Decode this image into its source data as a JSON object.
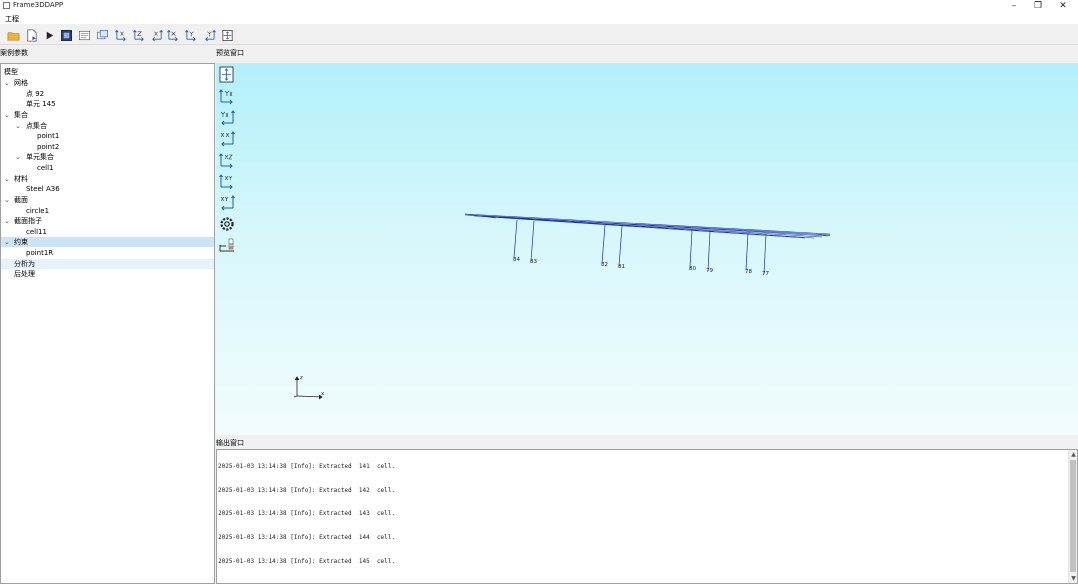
{
  "window": {
    "title": "Frame3DDAPP",
    "controls": {
      "minimize": "–",
      "restore": "❐",
      "close": "✕"
    }
  },
  "menu": {
    "items": [
      "工程"
    ]
  },
  "toolbar": {
    "buttons": [
      "folder-icon",
      "new-file-icon",
      "run-icon",
      "model-view-icon",
      "frame-view-icon",
      "window-view-icon",
      "view-yz-icon",
      "view-zy-icon",
      "view-xz-icon",
      "view-zx-icon",
      "view-xy-icon",
      "view-yx-icon",
      "fit-view-icon"
    ]
  },
  "panels": {
    "left_label": "案例参数",
    "center_label": "预览窗口",
    "log_label": "输出窗口"
  },
  "tree": [
    {
      "label": "模型",
      "level": 0
    },
    {
      "label": "网格",
      "level": 1,
      "expanded": true
    },
    {
      "label": "点 92",
      "level": 2
    },
    {
      "label": "单元 145",
      "level": 2
    },
    {
      "label": "集合",
      "level": 1,
      "expanded": true
    },
    {
      "label": "点集合",
      "level": 2,
      "expanded": true
    },
    {
      "label": "point1",
      "level": 3
    },
    {
      "label": "point2",
      "level": 3
    },
    {
      "label": "单元集合",
      "level": 2,
      "expanded": true
    },
    {
      "label": "cell1",
      "level": 3
    },
    {
      "label": "材料",
      "level": 1,
      "expanded": true
    },
    {
      "label": "Steel A36",
      "level": 2
    },
    {
      "label": "截面",
      "level": 1,
      "expanded": true
    },
    {
      "label": "circle1",
      "level": 2
    },
    {
      "label": "截面指子",
      "level": 1,
      "expanded": true
    },
    {
      "label": "cell11",
      "level": 2
    },
    {
      "label": "约束",
      "level": 1,
      "expanded": true,
      "selected": true
    },
    {
      "label": "point1R",
      "level": 2
    },
    {
      "label": "分析为",
      "level": 1,
      "hover": true
    },
    {
      "label": "后处理",
      "level": 1
    }
  ],
  "viewport": {
    "tools": [
      "select-view-icon",
      "view-front-icon",
      "view-back-icon",
      "view-left-icon",
      "view-right-icon",
      "view-top-icon",
      "view-bottom-icon",
      "settings-icon",
      "legend-icon"
    ],
    "labels": [
      "84",
      "83",
      "82",
      "81",
      "80",
      "79",
      "78",
      "77"
    ],
    "axis_labels": {
      "x": "x",
      "z": "z"
    },
    "accent_color": "#1a2fa8",
    "bg_top": "#b2f0fb",
    "bg_bottom": "#f2fcfd"
  },
  "log": {
    "lines": [
      "2025-01-03 13:14:38 [Info]: Extracted  141  cell.",
      "2025-01-03 13:14:38 [Info]: Extracted  142  cell.",
      "2025-01-03 13:14:38 [Info]: Extracted  143  cell.",
      "2025-01-03 13:14:38 [Info]: Extracted  144  cell.",
      "2025-01-03 13:14:38 [Info]: Extracted  145  cell."
    ]
  }
}
